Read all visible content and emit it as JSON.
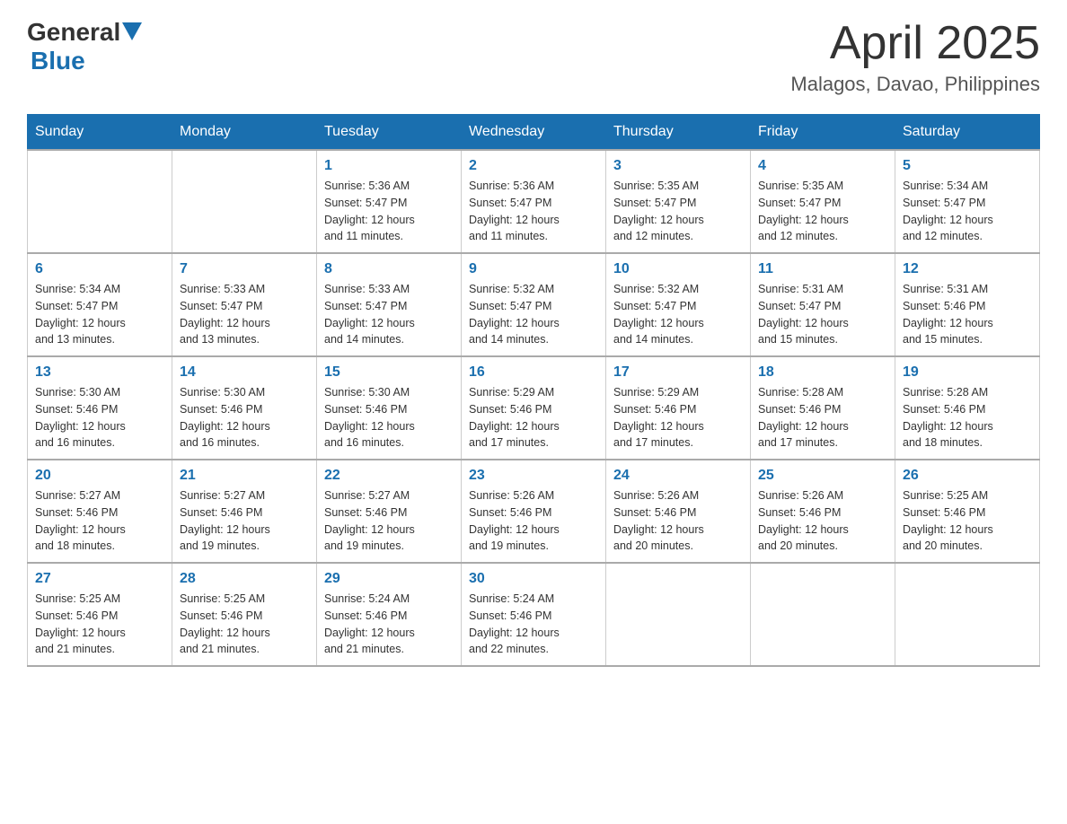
{
  "logo": {
    "text_general": "General",
    "text_blue": "Blue"
  },
  "title": "April 2025",
  "subtitle": "Malagos, Davao, Philippines",
  "days_of_week": [
    "Sunday",
    "Monday",
    "Tuesday",
    "Wednesday",
    "Thursday",
    "Friday",
    "Saturday"
  ],
  "weeks": [
    [
      {
        "day": "",
        "info": ""
      },
      {
        "day": "",
        "info": ""
      },
      {
        "day": "1",
        "info": "Sunrise: 5:36 AM\nSunset: 5:47 PM\nDaylight: 12 hours\nand 11 minutes."
      },
      {
        "day": "2",
        "info": "Sunrise: 5:36 AM\nSunset: 5:47 PM\nDaylight: 12 hours\nand 11 minutes."
      },
      {
        "day": "3",
        "info": "Sunrise: 5:35 AM\nSunset: 5:47 PM\nDaylight: 12 hours\nand 12 minutes."
      },
      {
        "day": "4",
        "info": "Sunrise: 5:35 AM\nSunset: 5:47 PM\nDaylight: 12 hours\nand 12 minutes."
      },
      {
        "day": "5",
        "info": "Sunrise: 5:34 AM\nSunset: 5:47 PM\nDaylight: 12 hours\nand 12 minutes."
      }
    ],
    [
      {
        "day": "6",
        "info": "Sunrise: 5:34 AM\nSunset: 5:47 PM\nDaylight: 12 hours\nand 13 minutes."
      },
      {
        "day": "7",
        "info": "Sunrise: 5:33 AM\nSunset: 5:47 PM\nDaylight: 12 hours\nand 13 minutes."
      },
      {
        "day": "8",
        "info": "Sunrise: 5:33 AM\nSunset: 5:47 PM\nDaylight: 12 hours\nand 14 minutes."
      },
      {
        "day": "9",
        "info": "Sunrise: 5:32 AM\nSunset: 5:47 PM\nDaylight: 12 hours\nand 14 minutes."
      },
      {
        "day": "10",
        "info": "Sunrise: 5:32 AM\nSunset: 5:47 PM\nDaylight: 12 hours\nand 14 minutes."
      },
      {
        "day": "11",
        "info": "Sunrise: 5:31 AM\nSunset: 5:47 PM\nDaylight: 12 hours\nand 15 minutes."
      },
      {
        "day": "12",
        "info": "Sunrise: 5:31 AM\nSunset: 5:46 PM\nDaylight: 12 hours\nand 15 minutes."
      }
    ],
    [
      {
        "day": "13",
        "info": "Sunrise: 5:30 AM\nSunset: 5:46 PM\nDaylight: 12 hours\nand 16 minutes."
      },
      {
        "day": "14",
        "info": "Sunrise: 5:30 AM\nSunset: 5:46 PM\nDaylight: 12 hours\nand 16 minutes."
      },
      {
        "day": "15",
        "info": "Sunrise: 5:30 AM\nSunset: 5:46 PM\nDaylight: 12 hours\nand 16 minutes."
      },
      {
        "day": "16",
        "info": "Sunrise: 5:29 AM\nSunset: 5:46 PM\nDaylight: 12 hours\nand 17 minutes."
      },
      {
        "day": "17",
        "info": "Sunrise: 5:29 AM\nSunset: 5:46 PM\nDaylight: 12 hours\nand 17 minutes."
      },
      {
        "day": "18",
        "info": "Sunrise: 5:28 AM\nSunset: 5:46 PM\nDaylight: 12 hours\nand 17 minutes."
      },
      {
        "day": "19",
        "info": "Sunrise: 5:28 AM\nSunset: 5:46 PM\nDaylight: 12 hours\nand 18 minutes."
      }
    ],
    [
      {
        "day": "20",
        "info": "Sunrise: 5:27 AM\nSunset: 5:46 PM\nDaylight: 12 hours\nand 18 minutes."
      },
      {
        "day": "21",
        "info": "Sunrise: 5:27 AM\nSunset: 5:46 PM\nDaylight: 12 hours\nand 19 minutes."
      },
      {
        "day": "22",
        "info": "Sunrise: 5:27 AM\nSunset: 5:46 PM\nDaylight: 12 hours\nand 19 minutes."
      },
      {
        "day": "23",
        "info": "Sunrise: 5:26 AM\nSunset: 5:46 PM\nDaylight: 12 hours\nand 19 minutes."
      },
      {
        "day": "24",
        "info": "Sunrise: 5:26 AM\nSunset: 5:46 PM\nDaylight: 12 hours\nand 20 minutes."
      },
      {
        "day": "25",
        "info": "Sunrise: 5:26 AM\nSunset: 5:46 PM\nDaylight: 12 hours\nand 20 minutes."
      },
      {
        "day": "26",
        "info": "Sunrise: 5:25 AM\nSunset: 5:46 PM\nDaylight: 12 hours\nand 20 minutes."
      }
    ],
    [
      {
        "day": "27",
        "info": "Sunrise: 5:25 AM\nSunset: 5:46 PM\nDaylight: 12 hours\nand 21 minutes."
      },
      {
        "day": "28",
        "info": "Sunrise: 5:25 AM\nSunset: 5:46 PM\nDaylight: 12 hours\nand 21 minutes."
      },
      {
        "day": "29",
        "info": "Sunrise: 5:24 AM\nSunset: 5:46 PM\nDaylight: 12 hours\nand 21 minutes."
      },
      {
        "day": "30",
        "info": "Sunrise: 5:24 AM\nSunset: 5:46 PM\nDaylight: 12 hours\nand 22 minutes."
      },
      {
        "day": "",
        "info": ""
      },
      {
        "day": "",
        "info": ""
      },
      {
        "day": "",
        "info": ""
      }
    ]
  ]
}
